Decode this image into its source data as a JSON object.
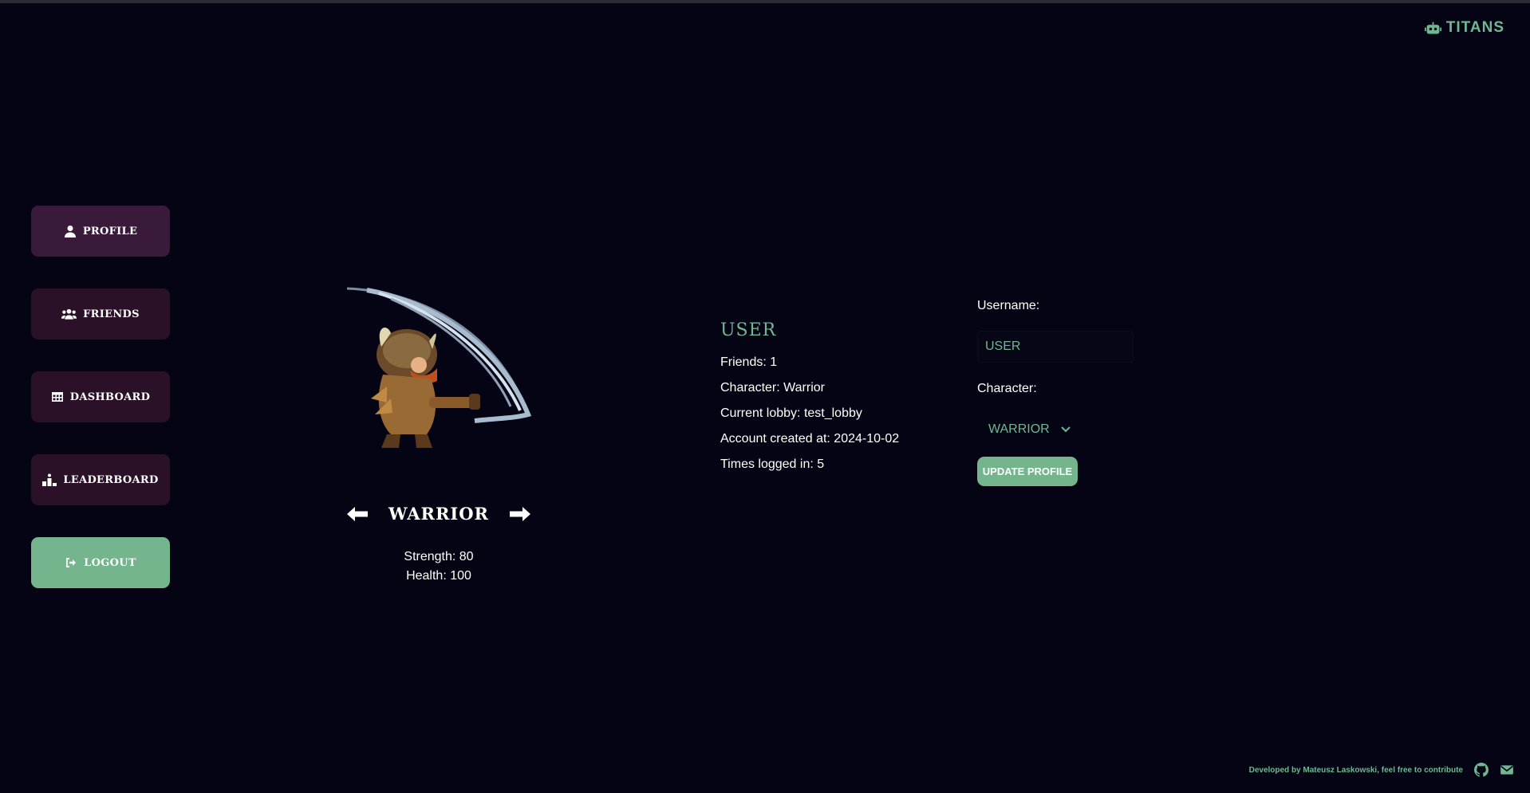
{
  "brand": {
    "name": "TITANS",
    "icon": "robot-icon"
  },
  "nav": {
    "items": [
      {
        "label": "PROFILE",
        "icon": "user-icon"
      },
      {
        "label": "FRIENDS",
        "icon": "users-icon"
      },
      {
        "label": "DASHBOARD",
        "icon": "table-icon"
      },
      {
        "label": "LEADERBOARD",
        "icon": "ranking-icon"
      },
      {
        "label": "LOGOUT",
        "icon": "logout-icon"
      }
    ]
  },
  "character": {
    "name": "WARRIOR",
    "strength": "Strength: 80",
    "health": "Health: 100"
  },
  "user": {
    "name": "USER",
    "friends": "Friends: 1",
    "character": "Character: Warrior",
    "lobby": "Current lobby: test_lobby",
    "created": "Account created at: 2024-10-02",
    "logins": "Times logged in: 5"
  },
  "form": {
    "username_label": "Username:",
    "username_value": "USER",
    "character_label": "Character:",
    "character_value": "WARRIOR",
    "update_label": "UPDATE PROFILE"
  },
  "footer": {
    "text": "Developed by Mateusz Laskowski, feel free to contribute"
  },
  "colors": {
    "accent": "#74b58e",
    "nav_bg": "#2a1128",
    "bg": "#050414"
  }
}
